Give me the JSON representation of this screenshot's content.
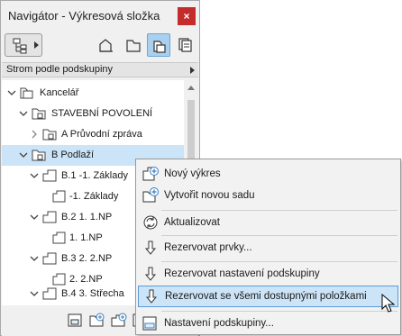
{
  "window": {
    "title": "Navigátor - Výkresová složka",
    "close_label": "×"
  },
  "toolbar": {
    "icons": [
      "navigator-tree-icon",
      "project-map-icon",
      "view-map-icon",
      "layout-book-icon",
      "publisher-sets-icon"
    ],
    "active": "layout-book-icon"
  },
  "dropdown": {
    "label": "Strom podle podskupiny"
  },
  "tree": {
    "items": [
      {
        "label": "Kancelář",
        "icon": "book-icon"
      },
      {
        "label": "STAVEBNÍ POVOLENÍ",
        "icon": "folder-icon"
      },
      {
        "label": "A Průvodní zpráva",
        "icon": "folder-icon"
      },
      {
        "label": "B Podlaží",
        "icon": "folder-icon"
      },
      {
        "label": "B.1 -1. Základy",
        "icon": "layout-icon"
      },
      {
        "label": "-1. Základy",
        "icon": "drawing-icon"
      },
      {
        "label": "B.2 1. 1.NP",
        "icon": "layout-icon"
      },
      {
        "label": "1. 1.NP",
        "icon": "drawing-icon"
      },
      {
        "label": "B.3 2. 2.NP",
        "icon": "layout-icon"
      },
      {
        "label": "2. 2.NP",
        "icon": "drawing-icon"
      },
      {
        "label": "B.4 3. Střecha",
        "icon": "layout-icon"
      }
    ],
    "selected_index": 3
  },
  "context_menu": {
    "items": [
      {
        "label": "Nový výkres",
        "icon": "new-layout-icon"
      },
      {
        "label": "Vytvořit novou sadu",
        "icon": "new-subset-icon"
      },
      {
        "label": "Aktualizovat",
        "icon": "refresh-icon"
      },
      {
        "label": "Rezervovat prvky...",
        "icon": "reserve-arrow-icon"
      },
      {
        "label": "Rezervovat nastavení podskupiny",
        "icon": "reserve-arrow-icon"
      },
      {
        "label": "Rezervovat se všemi dostupnými položkami",
        "icon": "reserve-arrow-icon"
      },
      {
        "label": "Nastavení podskupiny...",
        "icon": "subset-settings-icon"
      }
    ],
    "highlighted_index": 5
  },
  "colors": {
    "selection": "#cce4f7",
    "highlight_border": "#5b9bd5",
    "active_tool": "#a9d0ee",
    "close": "#c42b2b"
  }
}
